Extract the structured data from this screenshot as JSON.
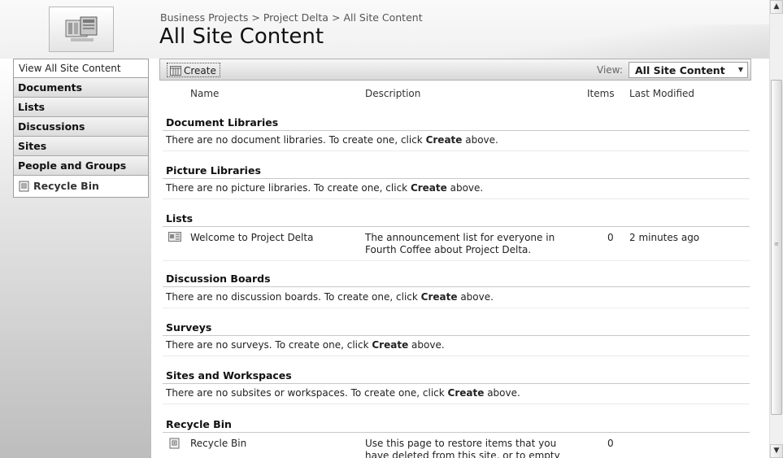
{
  "header": {
    "breadcrumb": [
      "Business Projects",
      "Project Delta",
      "All Site Content"
    ],
    "breadcrumb_separator": ">",
    "title": "All Site Content"
  },
  "leftnav": {
    "view_all": "View All Site Content",
    "items": [
      "Documents",
      "Lists",
      "Discussions",
      "Sites",
      "People and Groups"
    ],
    "recycle_bin": "Recycle Bin"
  },
  "toolbar": {
    "create_label": "Create",
    "view_label": "View:",
    "view_value": "All Site Content"
  },
  "columns": {
    "name": "Name",
    "description": "Description",
    "items": "Items",
    "last_modified": "Last Modified"
  },
  "sections": {
    "document_libraries": {
      "title": "Document Libraries",
      "empty_pre": "There are no document libraries. To create one, click ",
      "empty_bold": "Create",
      "empty_post": " above."
    },
    "picture_libraries": {
      "title": "Picture Libraries",
      "empty_pre": "There are no picture libraries. To create one, click ",
      "empty_bold": "Create",
      "empty_post": " above."
    },
    "lists": {
      "title": "Lists",
      "row": {
        "name": "Welcome to Project Delta",
        "description_line1": "The announcement list for everyone in",
        "description_line2": "Fourth Coffee about Project Delta.",
        "items": "0",
        "last_modified": "2 minutes ago"
      }
    },
    "discussion_boards": {
      "title": "Discussion Boards",
      "empty_pre": "There are no discussion boards. To create one, click ",
      "empty_bold": "Create",
      "empty_post": " above."
    },
    "surveys": {
      "title": "Surveys",
      "empty_pre": "There are no surveys. To create one, click ",
      "empty_bold": "Create",
      "empty_post": " above."
    },
    "sites_workspaces": {
      "title": "Sites and Workspaces",
      "empty_pre": "There are no subsites or workspaces. To create one, click ",
      "empty_bold": "Create",
      "empty_post": " above."
    },
    "recycle_bin": {
      "title": "Recycle Bin",
      "row": {
        "name": "Recycle Bin",
        "description_line1": "Use this page to restore items that you",
        "description_line2": "have deleted from this site, or to empty",
        "items": "0"
      }
    }
  },
  "icons": {
    "site": "site-logo-icon",
    "create": "create-icon",
    "list": "announcement-list-icon",
    "recycle": "recycle-bin-icon",
    "scroll_up": "scroll-up-arrow-icon",
    "scroll_down": "scroll-down-arrow-icon"
  }
}
